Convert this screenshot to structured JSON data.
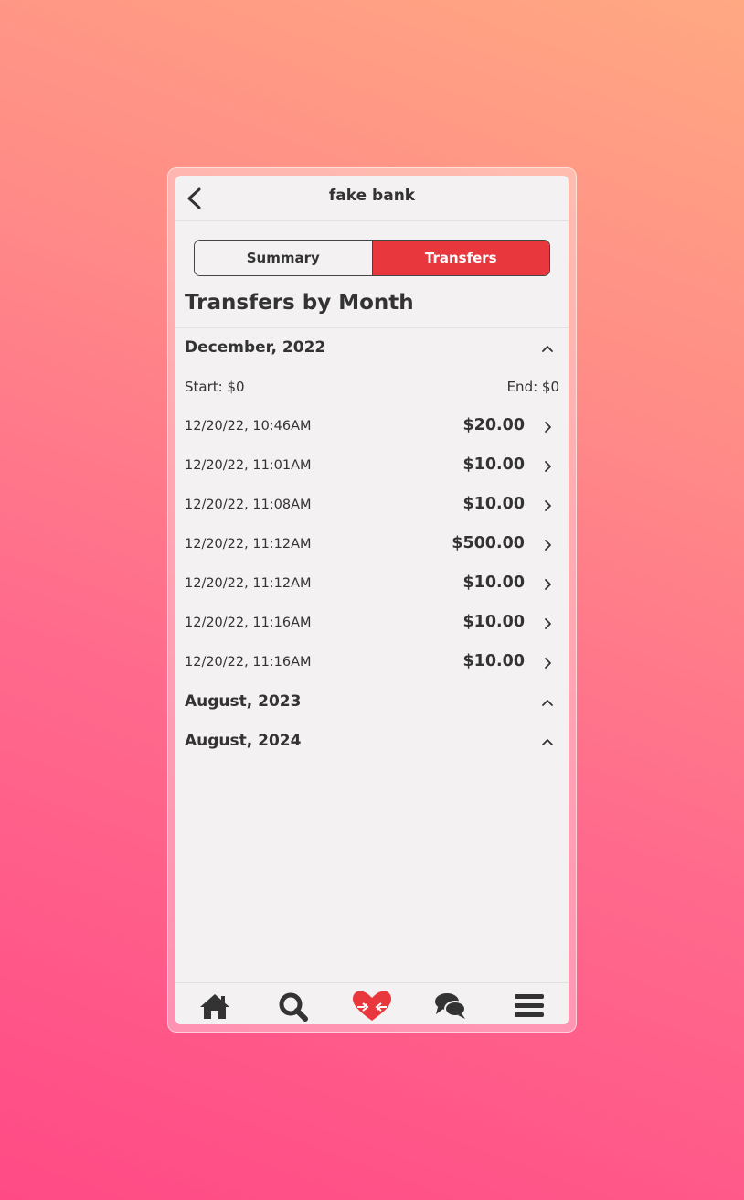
{
  "header": {
    "title": "fake bank"
  },
  "segments": {
    "summary": "Summary",
    "transfers": "Transfers"
  },
  "heading": "Transfers by Month",
  "months": [
    {
      "label": "December, 2022",
      "start": "Start: $0",
      "end": "End: $0",
      "transfers": [
        {
          "datetime": "12/20/22, 10:46AM",
          "amount": "$20.00"
        },
        {
          "datetime": "12/20/22, 11:01AM",
          "amount": "$10.00"
        },
        {
          "datetime": "12/20/22, 11:08AM",
          "amount": "$10.00"
        },
        {
          "datetime": "12/20/22, 11:12AM",
          "amount": "$500.00"
        },
        {
          "datetime": "12/20/22, 11:12AM",
          "amount": "$10.00"
        },
        {
          "datetime": "12/20/22, 11:16AM",
          "amount": "$10.00"
        },
        {
          "datetime": "12/20/22, 11:16AM",
          "amount": "$10.00"
        }
      ]
    },
    {
      "label": "August, 2023"
    },
    {
      "label": "August, 2024"
    }
  ],
  "tabbar": {
    "icons": [
      "home-icon",
      "search-icon",
      "heart-transfer-icon",
      "chat-bubbles-icon",
      "menu-icon"
    ]
  },
  "colors": {
    "accent": "#e9383d",
    "background": "#f3f1f2",
    "text": "#333333"
  }
}
